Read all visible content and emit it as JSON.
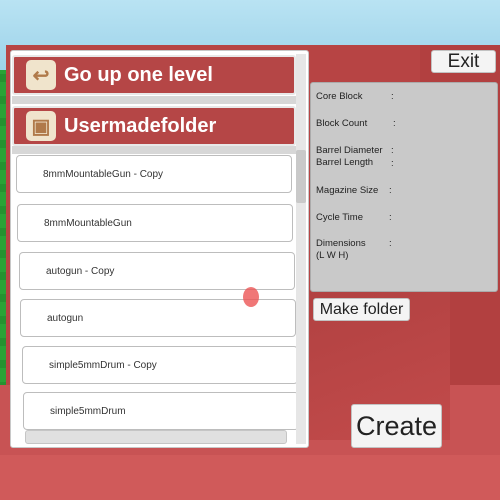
{
  "nav": {
    "up_label": "Go up one level",
    "up_icon": "return-arrow-icon",
    "folder_label": "Usermadefolder",
    "folder_icon": "folder-icon"
  },
  "files": [
    {
      "name": "8mmMountableGun - Copy"
    },
    {
      "name": "8mmMountableGun"
    },
    {
      "name": "autogun - Copy"
    },
    {
      "name": "autogun"
    },
    {
      "name": "simple5mmDrum - Copy"
    },
    {
      "name": "simple5mmDrum"
    }
  ],
  "info": {
    "core_block": "Core Block",
    "block_count": "Block Count",
    "barrel_diameter": "Barrel Diameter",
    "barrel_length": "Barrel Length",
    "magazine_size": "Magazine Size",
    "cycle_time": "Cycle Time",
    "dimensions": "Dimensions",
    "dimensions_sub": "(L W H)",
    "colon": ":"
  },
  "buttons": {
    "exit": "Exit",
    "make_folder": "Make folder",
    "create": "Create"
  },
  "colors": {
    "accent_red": "#b54646",
    "grass": "#2fb53c",
    "sky": "#8fcbe6"
  }
}
